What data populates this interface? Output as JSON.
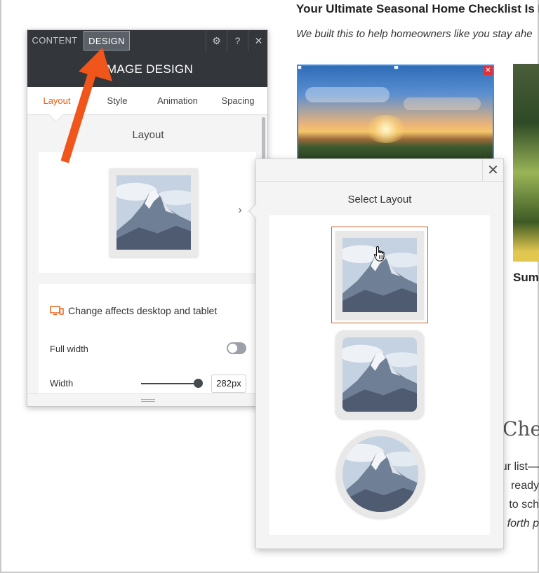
{
  "page": {
    "article_title": "Your Ultimate Seasonal Home Checklist Is R",
    "article_subtitle": "We built this to help homeowners like you stay ahe",
    "side_caption": "Sum",
    "check_heading": "Che",
    "body_lines": [
      "ur list—",
      "ready",
      "to sch",
      "forth p"
    ]
  },
  "panel": {
    "tabs": {
      "content": "CONTENT",
      "design": "DESIGN"
    },
    "tools": {
      "settings": "⚙",
      "help": "?",
      "close": "✕"
    },
    "title": "IMAGE DESIGN",
    "subtabs": {
      "layout": "Layout",
      "style": "Style",
      "animation": "Animation",
      "spacing": "Spacing"
    },
    "section_title": "Layout",
    "chevron": "›",
    "notice": "Change affects desktop and tablet",
    "full_width_label": "Full width",
    "full_width_on": false,
    "width_label": "Width",
    "width_value": "282px"
  },
  "popup": {
    "title": "Select Layout",
    "close": "✕",
    "options": [
      "square-frame",
      "rounded-frame",
      "circle-frame"
    ],
    "selected": "square-frame"
  },
  "colors": {
    "accent": "#e85c12",
    "arrow": "#f0561c",
    "dark_header": "#33363b",
    "selection_blue": "#3b8ee6"
  }
}
